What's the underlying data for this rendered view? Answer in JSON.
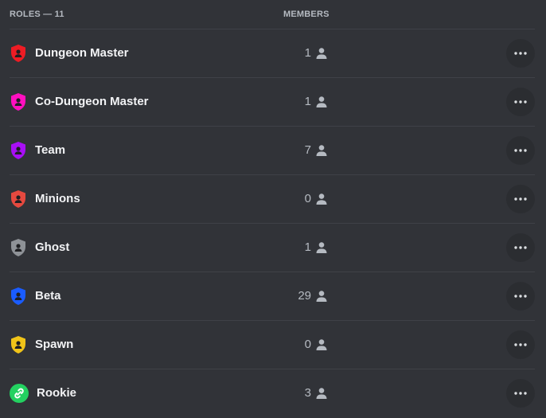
{
  "header": {
    "roles_label": "ROLES — 11",
    "members_label": "MEMBERS"
  },
  "roles": [
    {
      "name": "Dungeon Master",
      "count": "1",
      "color": "#ed1c24",
      "icon": "shield-person-icon"
    },
    {
      "name": "Co-Dungeon Master",
      "count": "1",
      "color": "#ff0fbf",
      "icon": "shield-person-icon"
    },
    {
      "name": "Team",
      "count": "7",
      "color": "#a80ff5",
      "icon": "shield-person-icon"
    },
    {
      "name": "Minions",
      "count": "0",
      "color": "#e5493f",
      "icon": "shield-person-icon"
    },
    {
      "name": "Ghost",
      "count": "1",
      "color": "#8e9297",
      "icon": "shield-person-icon"
    },
    {
      "name": "Beta",
      "count": "29",
      "color": "#1a5cff",
      "icon": "shield-person-icon"
    },
    {
      "name": "Spawn",
      "count": "0",
      "color": "#f0c419",
      "icon": "shield-person-icon"
    },
    {
      "name": "Rookie",
      "count": "3",
      "color": "#23d160",
      "icon": "link-icon"
    }
  ],
  "icons": {
    "member": "person-icon",
    "more": "more-options-icon"
  }
}
